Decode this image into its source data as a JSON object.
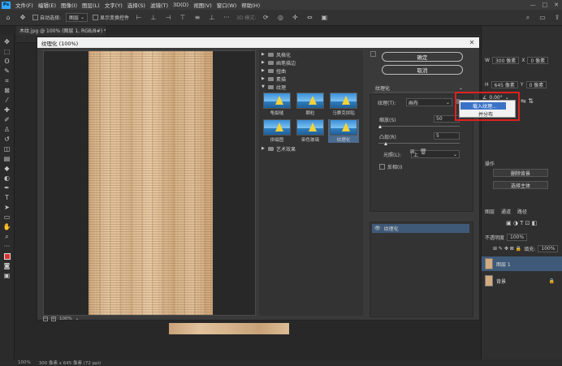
{
  "menu": [
    "文件(F)",
    "编辑(E)",
    "图像(I)",
    "图层(L)",
    "文字(Y)",
    "选择(S)",
    "滤镜(T)",
    "3D(D)",
    "视图(V)",
    "窗口(W)",
    "帮助(H)"
  ],
  "app_logo": "Ps",
  "options": {
    "auto_select": "自动选择:",
    "auto_select_value": "图层",
    "show_transform": "显示变换控件",
    "mode_3d": "3D 模式:"
  },
  "doc_tab": "木纹.jpg @ 100% (图层 1, RGB/8#) *",
  "status": {
    "zoom": "100%",
    "size": "300 像素 x 645 像素 (72 ppi)"
  },
  "dialog": {
    "title": "纹理化 (100%)",
    "ok": "确定",
    "cancel": "取消",
    "zoom": "100%",
    "filter_select": "纹理化",
    "categories": [
      {
        "name": "风格化",
        "open": false
      },
      {
        "name": "画笔描边",
        "open": false
      },
      {
        "name": "扭曲",
        "open": false
      },
      {
        "name": "素描",
        "open": false
      },
      {
        "name": "纹理",
        "open": true
      }
    ],
    "last_category": "艺术效果",
    "thumbs": [
      {
        "label": "龟裂缝",
        "selected": false
      },
      {
        "label": "颗粒",
        "selected": false
      },
      {
        "label": "马赛克拼贴",
        "selected": false
      },
      {
        "label": "拼缀图",
        "selected": false
      },
      {
        "label": "染色玻璃",
        "selected": false
      },
      {
        "label": "纹理化",
        "selected": true
      }
    ],
    "params": {
      "texture_label": "纹理(T):",
      "texture_value": "画布",
      "scale_label": "缩放(S)",
      "scale_value": "50",
      "relief_label": "凸现(R)",
      "relief_value": "5",
      "light_label": "光照(L):",
      "light_value": "上",
      "invert_label": "反相(I)"
    },
    "layer_item": "纹理化"
  },
  "context_menu": {
    "item1": "载入纹理...",
    "item2": "并分布"
  },
  "angle": "0.00°",
  "right_panel": {
    "w_label": "W",
    "w_value": "300 像素",
    "h_label": "H",
    "h_value": "645 像素",
    "x_label": "X",
    "x_value": "0 像素",
    "y_label": "Y",
    "y_value": "0 像素",
    "quick_actions": "操作",
    "remove_bg": "删除背景",
    "select_subject": "选择主体",
    "layers_tab": "图层",
    "channels_tab": "通道",
    "paths_tab": "路径",
    "opacity_label": "不透明度",
    "fill_label": "填充:",
    "opacity_value": "100%",
    "fill_value": "100%",
    "layers": [
      {
        "name": "图层 1",
        "selected": true
      },
      {
        "name": "背景",
        "selected": false
      }
    ]
  }
}
